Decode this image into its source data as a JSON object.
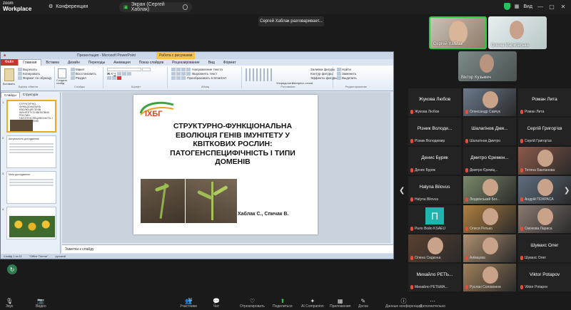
{
  "app": {
    "brand_small": "zoom",
    "brand_big": "Workplace"
  },
  "topbar": {
    "conference_label": "Конференция",
    "share_label": "Экран (Сергей Хаблак)",
    "view_label": "Вид"
  },
  "toast": {
    "text": "Сергей Хаблак разговаривает..."
  },
  "videos": [
    {
      "label": "Сергей Хаблак",
      "active": true
    },
    {
      "label": "Олена Марковська",
      "active": false
    },
    {
      "label": "Віктор Кузьмич",
      "active": false
    }
  ],
  "ppt": {
    "title": "Презентация - Microsoft PowerPoint",
    "tools_label": "Работа с рисунками",
    "tabs": [
      "Файл",
      "Главная",
      "Вставка",
      "Дизайн",
      "Переходы",
      "Анимация",
      "Показ слайдов",
      "Рецензирование",
      "Вид",
      "Формат"
    ],
    "ribbon": {
      "clipboard": {
        "paste": "Вставить",
        "cut": "Вырезать",
        "copy": "Копировать",
        "format": "Формат по образцу",
        "group": "Буфер обмена"
      },
      "slides": {
        "create": "Создать слайд",
        "layout": "Макет",
        "reset": "Восстановить",
        "section": "Раздел",
        "group": "Слайды"
      },
      "font_group": "Шрифт",
      "paragraph": {
        "direction": "Направление текста",
        "align": "Выровнять текст",
        "smartart": "Преобразовать в SmartArt",
        "group": "Абзац"
      },
      "drawing": {
        "arrange": "Упорядочить",
        "styles": "Экспресс-стили",
        "fill": "Заливка фигуры",
        "outline": "Контур фигуры",
        "effects": "Эффекты фигуры",
        "group": "Рисование"
      },
      "editing": {
        "find": "Найти",
        "replace": "Заменить",
        "select": "Выделить",
        "group": "Редактирование"
      }
    },
    "side_tabs": [
      "Слайды",
      "Структура"
    ],
    "thumbnails": [
      {
        "num": "1",
        "title": "СТРУКТУРНО-ФУНКЦІОНАЛЬНА ЕВОЛЮЦІЯ ГЕНІВ ІМУНІТЕТУ В КВІТКОВИХ РОСЛИН: ПАТОГЕНСПЕЦИФІЧНІСТЬ І ТИПИ ДОМЕНІВ"
      },
      {
        "num": "2",
        "title": "Актуальність дослідження"
      },
      {
        "num": "3",
        "title": "Мета дослідження"
      },
      {
        "num": "4",
        "title": ""
      }
    ],
    "slide": {
      "logo": "ІХБГ",
      "title": "СТРУКТУРНО-ФУНКЦІОНАЛЬНА ЕВОЛЮЦІЯ ГЕНІВ ІМУНІТЕТУ У КВІТКОВИХ РОСЛИН: ПАТОГЕНСПЕЦИФІЧНІСТЬ І ТИПИ ДОМЕНІВ",
      "authors": "Хаблак С., Спичак В."
    },
    "notes_placeholder": "Заметки к слайду",
    "status": {
      "slide": "Слайд 1 из 11",
      "theme": "\"Office Theme\"",
      "lang": "русский"
    }
  },
  "gallery": {
    "tiles": [
      {
        "name": "Жукова Любов",
        "footer": "Жукова Любов",
        "video": false
      },
      {
        "name": "",
        "footer": "Олександр Савчук",
        "video": true,
        "color": "#6b7a8c"
      },
      {
        "name": "Роман Лита",
        "footer": "Роман Лита",
        "video": false
      },
      {
        "name": "Різник Володи...",
        "footer": "Різник Володимир",
        "video": false
      },
      {
        "name": "Шалагінов Дми...",
        "footer": "Шалагінов Дмитро",
        "video": false
      },
      {
        "name": "Сергій Григор'єв",
        "footer": "Сергій Григор'єв",
        "video": false
      },
      {
        "name": "Денис Буряк",
        "footer": "Денис Буряк",
        "video": false
      },
      {
        "name": "Дмитро Єремен...",
        "footer": "Дмитро Єреміц...",
        "video": false
      },
      {
        "name": "",
        "footer": "Тетяна Бакланова",
        "video": true,
        "color": "#8c5a4a"
      },
      {
        "name": "Halyna Bilovus",
        "footer": "Halyna Bilovus",
        "video": false
      },
      {
        "name": "",
        "footer": "Людвінський Бог...",
        "video": true,
        "color": "#7a8a6a"
      },
      {
        "name": "",
        "footer": "Андрій ПОКРАСА",
        "video": true,
        "color": "#5f6e80"
      },
      {
        "name": "П",
        "footer": "Рало Войо KSAEU",
        "video": false,
        "initial": true
      },
      {
        "name": "",
        "footer": "Олеся Ретько",
        "video": true,
        "color": "#b08040"
      },
      {
        "name": "",
        "footer": "Смокова Лариса",
        "video": true,
        "color": "#8a7a70"
      },
      {
        "name": "",
        "footer": "Олена Сидкона",
        "video": true,
        "color": "#5a4030"
      },
      {
        "name": "",
        "footer": "Алімцова",
        "video": true,
        "color": "#b09070"
      },
      {
        "name": "Шувахс Олег",
        "footer": "Шувахс Олег",
        "video": false
      },
      {
        "name": "Михайло РЕТЬ...",
        "footer": "Михайло РЕТЬМА...",
        "video": false
      },
      {
        "name": "",
        "footer": "Руслан Соловонов",
        "video": true,
        "color": "#a0805a"
      },
      {
        "name": "Viktor Potapov",
        "footer": "Viktor Potapov",
        "video": false
      }
    ]
  },
  "toolbar": {
    "items": [
      {
        "icon": "🎙",
        "label": "Звук"
      },
      {
        "icon": "📷",
        "label": "Видео"
      },
      {
        "icon": "👥",
        "label": "Участники",
        "count": "51"
      },
      {
        "icon": "💬",
        "label": "Чат"
      },
      {
        "icon": "♡",
        "label": "Отреагировать"
      },
      {
        "icon": "⬆",
        "label": "Поделиться"
      },
      {
        "icon": "✦",
        "label": "AI Companion"
      },
      {
        "icon": "▦",
        "label": "Приложения"
      },
      {
        "icon": "✎",
        "label": "Доска"
      },
      {
        "icon": "ⓘ",
        "label": "Данные конференции"
      },
      {
        "icon": "⋯",
        "label": "Дополнительно"
      }
    ]
  }
}
